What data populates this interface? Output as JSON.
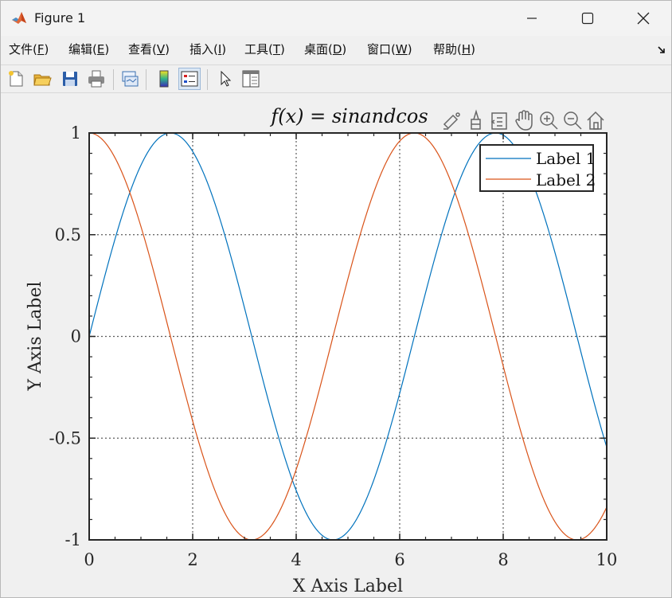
{
  "window": {
    "title": "Figure 1",
    "controls": [
      "minimize",
      "maximize",
      "close"
    ]
  },
  "menubar": {
    "items": [
      {
        "label": "文件(",
        "key": "F",
        "suffix": ")"
      },
      {
        "label": "编辑(",
        "key": "E",
        "suffix": ")"
      },
      {
        "label": "查看(",
        "key": "V",
        "suffix": ")"
      },
      {
        "label": "插入(",
        "key": "I",
        "suffix": ")"
      },
      {
        "label": "工具(",
        "key": "T",
        "suffix": ")"
      },
      {
        "label": "桌面(",
        "key": "D",
        "suffix": ")"
      },
      {
        "label": "窗口(",
        "key": "W",
        "suffix": ")"
      },
      {
        "label": "帮助(",
        "key": "H",
        "suffix": ")"
      }
    ]
  },
  "toolbar": {
    "buttons": [
      "new-figure-icon",
      "open-file-icon",
      "save-icon",
      "print-icon",
      "link-plot-icon",
      "colorbar-icon",
      "legend-icon",
      "pointer-icon",
      "property-inspector-icon"
    ],
    "active": "legend-icon"
  },
  "axes_toolbar": {
    "buttons": [
      "brush-icon",
      "data-tips-icon",
      "restore-icon",
      "pan-icon",
      "zoom-in-icon",
      "zoom-out-icon",
      "home-icon"
    ]
  },
  "chart_data": {
    "type": "line",
    "title": "f(x) = sinandcos",
    "xlabel": "X Axis Label",
    "ylabel": "Y Axis Label",
    "xlim": [
      0,
      10
    ],
    "ylim": [
      -1,
      1
    ],
    "xticks": [
      "0",
      "2",
      "4",
      "6",
      "8",
      "10"
    ],
    "yticks": [
      "1",
      "0.5",
      "0",
      "-0.5",
      "-1"
    ],
    "grid": true,
    "legend_position": "top-right",
    "series": [
      {
        "name": "Label 1",
        "function": "sin(x)",
        "color": "#0072BD"
      },
      {
        "name": "Label 2",
        "function": "cos(x)",
        "color": "#D95319"
      }
    ]
  }
}
